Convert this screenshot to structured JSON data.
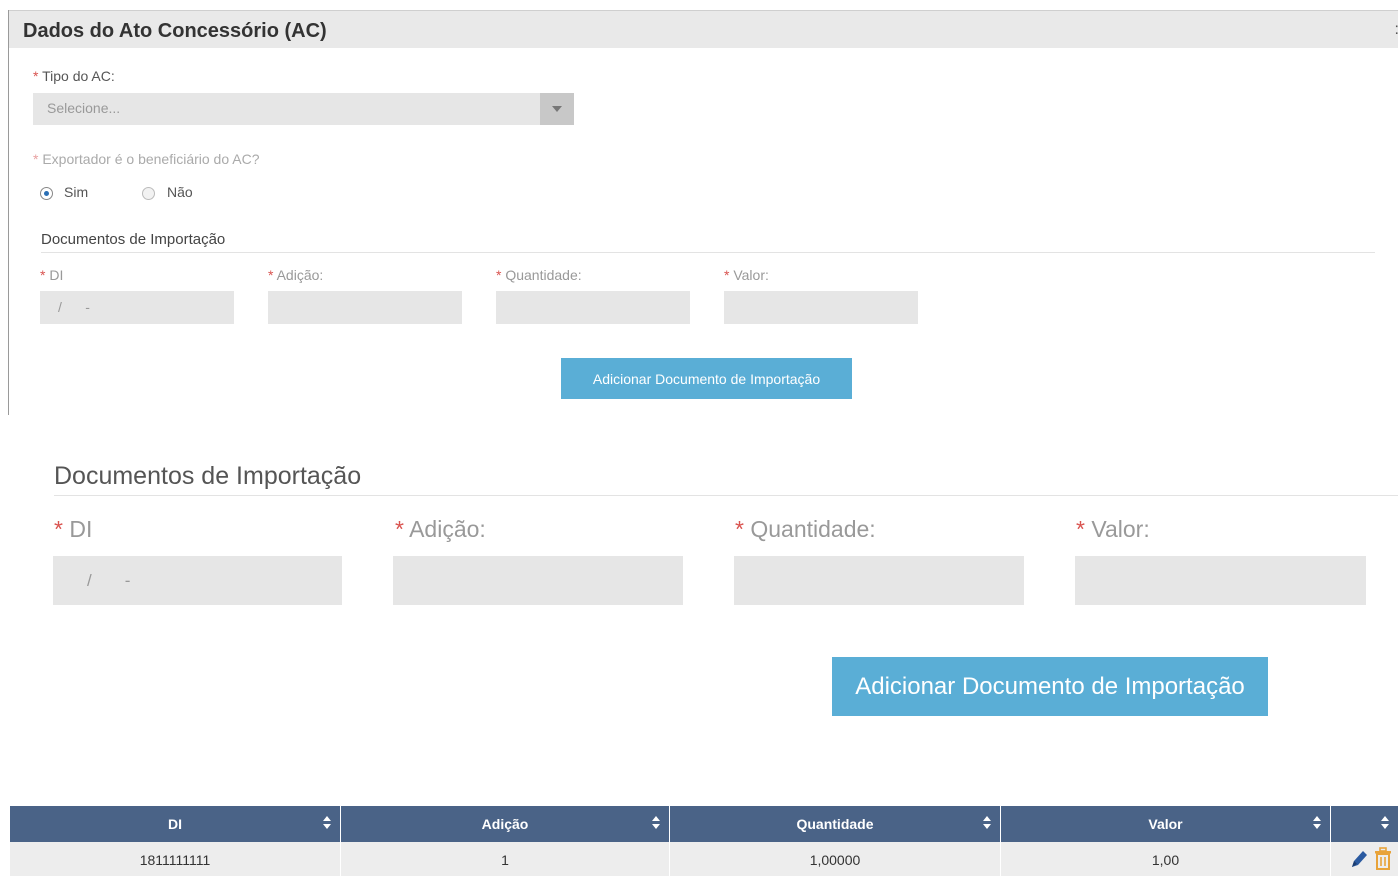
{
  "panel": {
    "title": "Dados do Ato Concessório (AC)",
    "more_glyph": ":"
  },
  "form_small": {
    "tipo_label": "Tipo do AC:",
    "tipo_placeholder": "Selecione...",
    "exportador_label": "Exportador é o beneficiário do AC?",
    "radio_sim": "Sim",
    "radio_nao": "Não",
    "radio_selected": "Sim",
    "section_title": "Documentos de Importação",
    "di_label": "DI",
    "adicao_label": "Adição:",
    "quantidade_label": "Quantidade:",
    "valor_label": "Valor:",
    "di_mask": "/      -",
    "add_button": "Adicionar Documento de Importação"
  },
  "form_large": {
    "section_title": "Documentos de Importação",
    "di_label": "DI",
    "adicao_label": "Adição:",
    "quantidade_label": "Quantidade:",
    "valor_label": "Valor:",
    "di_mask": "/       -",
    "add_button": "Adicionar Documento de Importação"
  },
  "required_marker": "*",
  "table": {
    "columns": [
      "DI",
      "Adição",
      "Quantidade",
      "Valor"
    ],
    "rows": [
      {
        "di": "1811111111",
        "adicao": "1",
        "quantidade": "1,00000",
        "valor": "1,00"
      }
    ]
  },
  "colors": {
    "header_bg": "#4a6387",
    "button_bg": "#5aaed6",
    "required": "#d9534f",
    "edit_icon": "#2b5aa0",
    "delete_icon": "#e8a33a"
  }
}
